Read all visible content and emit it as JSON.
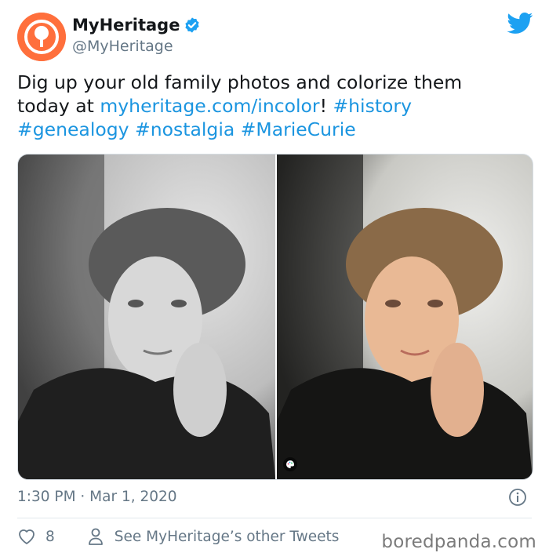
{
  "account": {
    "display_name": "MyHeritage",
    "handle": "@MyHeritage",
    "avatar_icon": "myheritage-logo-icon",
    "verified_icon": "verified-badge-icon",
    "brand_color": "#ff6f3c"
  },
  "tweet": {
    "text_plain_1": "Dig up your old family photos and colorize them today at ",
    "link_url": "myheritage.com/incolor",
    "text_plain_2": "! ",
    "hashtags": [
      "#history",
      "#genealogy",
      "#nostalgia",
      "#MarieCurie"
    ],
    "link_color": "#1b95e0"
  },
  "media": {
    "images": [
      {
        "label": "black-and-white original photo"
      },
      {
        "label": "colorized photo"
      }
    ],
    "badge_icon": "palette-icon"
  },
  "meta": {
    "timestamp": "1:30 PM · Mar 1, 2020",
    "info_icon": "info-icon"
  },
  "actions": {
    "like_count": "8",
    "other_tweets_label": "See MyHeritage’s other Tweets"
  },
  "watermark": "boredpanda.com"
}
